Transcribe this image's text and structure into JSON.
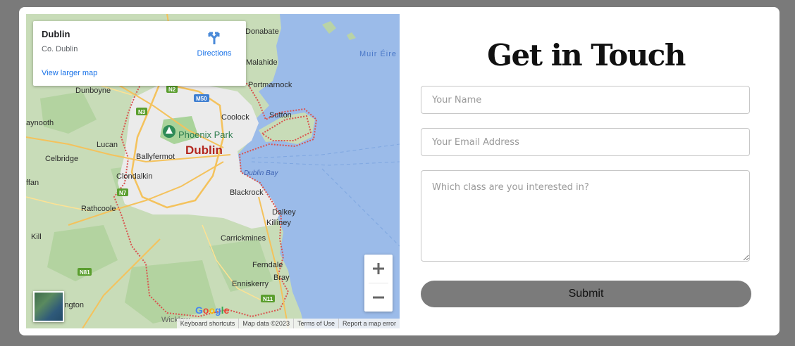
{
  "map": {
    "place_title": "Dublin",
    "place_subtitle": "Co. Dublin",
    "directions_label": "Directions",
    "view_larger_label": "View larger map",
    "labels": {
      "donabate": "Donabate",
      "muir_eireann": "Muir Éire",
      "malahide": "Malahide",
      "dunboyne": "Dunboyne",
      "portmarnock": "Portmarnock",
      "m50": "M50",
      "n2": "N2",
      "n3": "N3",
      "coolock": "Coolock",
      "sutton": "Sutton",
      "maynooth": "aynooth",
      "phoenix_park": "Phoenix Park",
      "lucan": "Lucan",
      "dublin": "Dublin",
      "ballyfermot": "Ballyfermot",
      "celbridge": "Celbridge",
      "clondalkin": "Clondalkin",
      "dublin_bay": "Dublin Bay",
      "naas": "ffan",
      "n7": "N7",
      "blackrock": "Blackrock",
      "rathcoole": "Rathcoole",
      "dalkey": "Dalkey",
      "killiney": "Killiney",
      "kill": "Kill",
      "carrickmines": "Carrickmines",
      "ferndale": "Ferndale",
      "n81": "N81",
      "enniskerry": "Enniskerry",
      "bray": "Bray",
      "n11": "N11",
      "blessington": "ington",
      "wicklow": "Wicklow"
    },
    "google_logo": "Google",
    "attribution": {
      "shortcuts": "Keyboard shortcuts",
      "map_data": "Map data ©2023",
      "terms": "Terms of Use",
      "report": "Report a map error"
    }
  },
  "contact": {
    "heading": "Get in Touch",
    "name_placeholder": "Your Name",
    "email_placeholder": "Your Email Address",
    "message_placeholder": "Which class are you interested in?",
    "submit_label": "Submit"
  },
  "colors": {
    "page_background": "#7a7a7a",
    "card_background": "#ffffff",
    "submit_background": "#7b7b7b",
    "water": "#9bbbe9",
    "land": "#c8dcb8",
    "urban": "#ebebeb",
    "boundary": "#d9534f",
    "link": "#1a73e8"
  }
}
